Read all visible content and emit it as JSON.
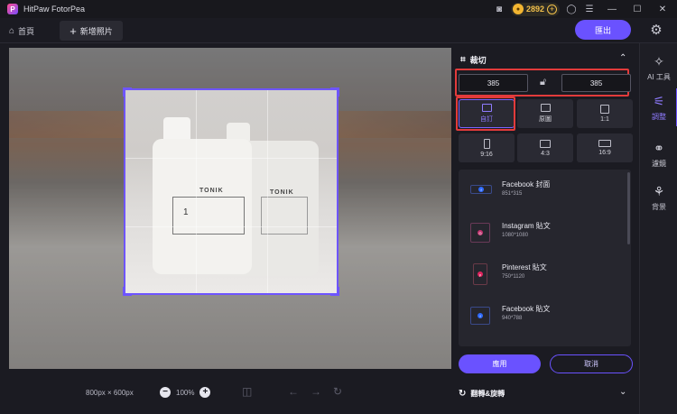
{
  "app": {
    "title": "HitPaw FotorPea"
  },
  "titlebar": {
    "coins": "2892"
  },
  "tabs": {
    "home_label": "首頁",
    "add_label": "新增照片"
  },
  "header": {
    "export_label": "匯出"
  },
  "canvas": {
    "dimensions": "800px × 600px",
    "zoom": "100%"
  },
  "crop_panel": {
    "title": "裁切",
    "width_value": "385",
    "height_value": "385",
    "ratios": [
      {
        "label": "自訂",
        "selected": true
      },
      {
        "label": "原圖",
        "selected": false
      },
      {
        "label": "1:1",
        "selected": false
      },
      {
        "label": "9:16",
        "selected": false
      },
      {
        "label": "4:3",
        "selected": false
      },
      {
        "label": "16:9",
        "selected": false
      }
    ],
    "presets": [
      {
        "name": "Facebook 封面",
        "size": "851*315",
        "icon": "facebook-icon"
      },
      {
        "name": "Instagram 貼文",
        "size": "1080*1080",
        "icon": "instagram-icon"
      },
      {
        "name": "Pinterest 貼文",
        "size": "750*1120",
        "icon": "pinterest-icon"
      },
      {
        "name": "Facebook 貼文",
        "size": "940*788",
        "icon": "facebook-icon"
      }
    ],
    "apply_label": "應用",
    "cancel_label": "取消",
    "flip_rotate_label": "翻轉&旋轉"
  },
  "sidenav": [
    {
      "label": "AI 工具",
      "icon": "ai-tools-icon"
    },
    {
      "label": "調整",
      "icon": "adjust-icon",
      "active": true
    },
    {
      "label": "濾鏡",
      "icon": "filter-icon"
    },
    {
      "label": "背景",
      "icon": "background-icon"
    }
  ],
  "colors": {
    "accent": "#6a52ff",
    "highlight": "#e23b3b",
    "background": "#1b1b22"
  }
}
